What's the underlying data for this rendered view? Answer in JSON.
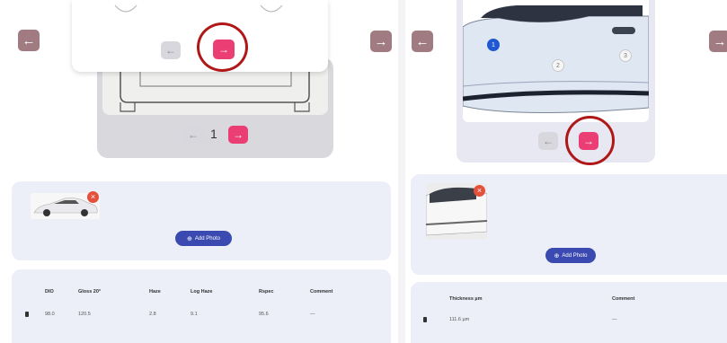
{
  "left_panel": {
    "nav_prev_icon": "arrow-left-icon",
    "nav_next_icon": "arrow-right-icon",
    "overlay_pager": {
      "prev_icon": "arrow-left-icon",
      "next_icon": "arrow-right-icon"
    },
    "pager": {
      "page": "1"
    },
    "photos": {
      "add_photo_label": "Add Photo",
      "badge_icon": "close-icon"
    },
    "table": {
      "headers": [
        "DIO",
        "Gloss 20°",
        "Haze",
        "Log Haze",
        "Rspec",
        "Comment"
      ],
      "rows": [
        [
          "98.0",
          "120.5",
          "2.8",
          "9.1",
          "95.6",
          "—"
        ]
      ]
    }
  },
  "right_panel": {
    "nav_prev_icon": "arrow-left-icon",
    "nav_next_icon": "arrow-right-icon",
    "hotspots": [
      "1",
      "2",
      "3"
    ],
    "photos": {
      "add_photo_label": "Add Photo",
      "badge_icon": "close-icon"
    },
    "table": {
      "headers": [
        "Thickness µm",
        "Comment"
      ],
      "rows": [
        [
          "111.6 µm",
          "—"
        ]
      ]
    }
  },
  "colors": {
    "accent_pink": "#ea3e74",
    "nav_mauve": "#a07c82",
    "button_blue": "#3b4ab0",
    "highlight_red": "#b01818",
    "card_bg": "#eceef8"
  }
}
